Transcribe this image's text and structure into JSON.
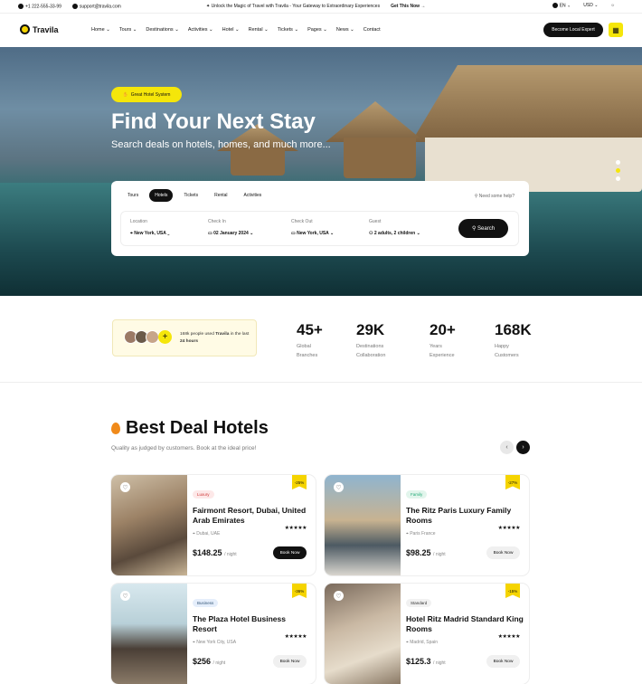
{
  "topbar": {
    "phone": "+1 222-555-33-99",
    "email": "support@travila.com",
    "promo": "Unlock the Magic of Travel with Travila - Your Gateway to Extraordinary Experiences",
    "promo_link": "Get This Now",
    "language": "EN",
    "currency": "USD"
  },
  "nav": {
    "brand": "Travila",
    "items": [
      "Home",
      "Tours",
      "Destinations",
      "Activities",
      "Hotel",
      "Rental",
      "Tickets",
      "Pages",
      "News",
      "Contact"
    ],
    "cta": "Become Local Expert"
  },
  "hero": {
    "badge": "Great Hotel System",
    "title": "Find Your Next Stay",
    "subtitle": "Search deals on hotels, homes, and much more..."
  },
  "search": {
    "tabs": [
      "Tours",
      "Hotels",
      "Tickets",
      "Rental",
      "Activities"
    ],
    "active_tab": "Hotels",
    "help": "Need some help?",
    "fields": [
      {
        "label": "Location",
        "value": "New York, USA"
      },
      {
        "label": "Check In",
        "value": "02 January 2024"
      },
      {
        "label": "Check Out",
        "value": "New York, USA"
      },
      {
        "label": "Guest",
        "value": "2 adults, 2 children"
      }
    ],
    "button": "Search"
  },
  "stats": {
    "people_text_prefix": "168k people used",
    "people_brand": "Travila",
    "people_text_mid": "in the last",
    "people_hours": "24 hours",
    "items": [
      {
        "number": "45+",
        "label1": "Global",
        "label2": "Branches"
      },
      {
        "number": "29K",
        "label1": "Destinations",
        "label2": "Collaboration"
      },
      {
        "number": "20+",
        "label1": "Years",
        "label2": "Experience"
      },
      {
        "number": "168K",
        "label1": "Happy",
        "label2": "Customers"
      }
    ]
  },
  "deals": {
    "title": "Best Deal Hotels",
    "subtitle": "Quality as judged by customers. Book at the ideal price!",
    "cards": [
      {
        "tag": "Luxury",
        "name": "Fairmont Resort, Dubai, United Arab Emirates",
        "location": "Dubai, UAE",
        "price": "$148.25",
        "unit": "/ night",
        "button": "Book Now",
        "discount": "-25%",
        "stars": "★★★★★"
      },
      {
        "tag": "Family",
        "name": "The Ritz Paris Luxury Family Rooms",
        "location": "Paris France",
        "price": "$98.25",
        "unit": "/ night",
        "button": "Book Now",
        "discount": "-27%",
        "stars": "★★★★★"
      },
      {
        "tag": "Business",
        "name": "The Plaza Hotel Business Resort",
        "location": "New York City, USA",
        "price": "$256",
        "unit": "/ night",
        "button": "Book Now",
        "discount": "-36%",
        "stars": "★★★★★"
      },
      {
        "tag": "Standard",
        "name": "Hotel Ritz Madrid Standard King Rooms",
        "location": "Madrid, Spain",
        "price": "$125.3",
        "unit": "/ night",
        "button": "Book Now",
        "discount": "-15%",
        "stars": "★★★★★"
      }
    ]
  },
  "colors": {
    "accent": "#f5e60a",
    "dark": "#111111"
  }
}
